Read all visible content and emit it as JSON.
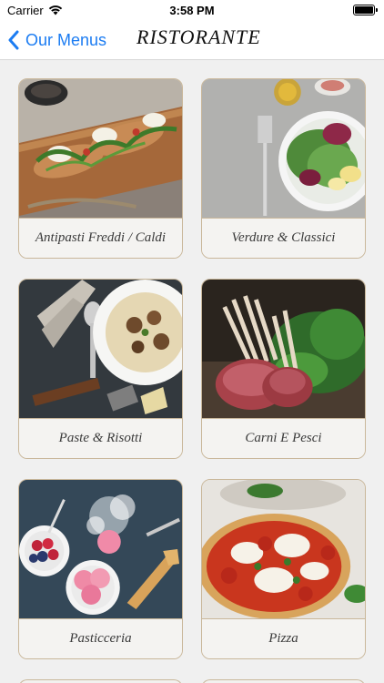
{
  "status": {
    "carrier": "Carrier",
    "time": "3:58 PM"
  },
  "nav": {
    "back_label": "Our Menus",
    "title": "RISTORANTE"
  },
  "menus": [
    {
      "label": "Antipasti Freddi / Caldi",
      "icon": "bruschetta-image"
    },
    {
      "label": "Verdure & Classici",
      "icon": "salad-image"
    },
    {
      "label": "Paste & Risotti",
      "icon": "risotto-image"
    },
    {
      "label": "Carni E Pesci",
      "icon": "lamb-rack-image"
    },
    {
      "label": "Pasticceria",
      "icon": "gelato-image"
    },
    {
      "label": "Pizza",
      "icon": "pizza-image"
    }
  ],
  "colors": {
    "accent": "#1b7cf2",
    "card_border": "#c9b79a"
  }
}
